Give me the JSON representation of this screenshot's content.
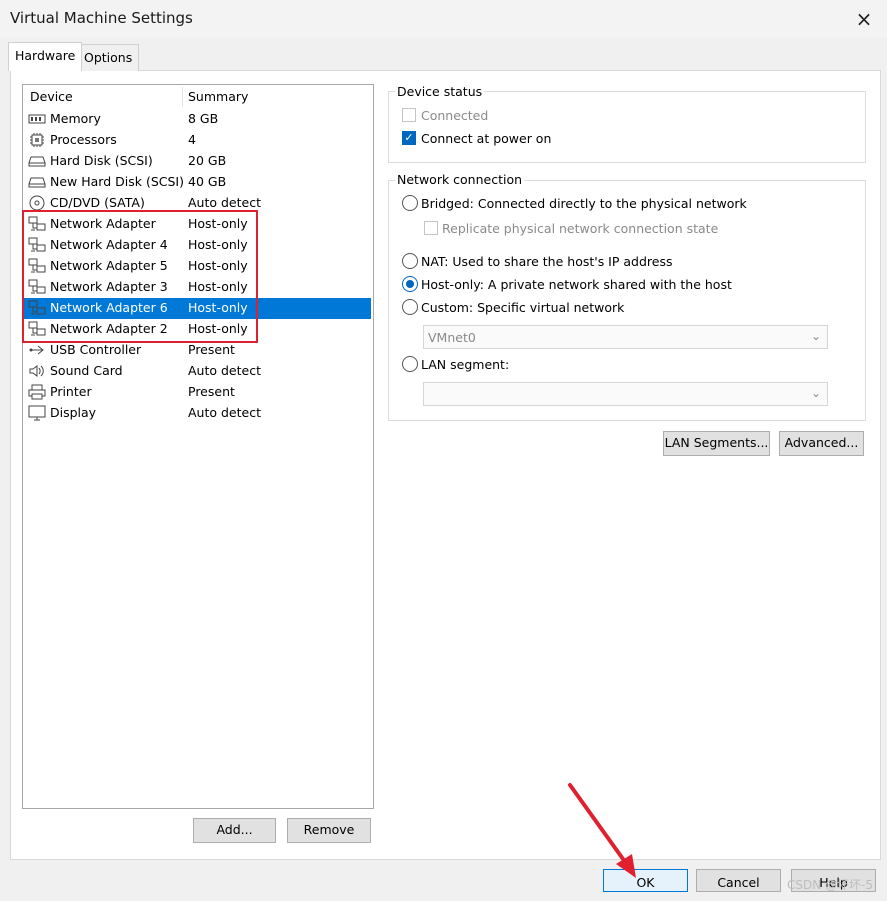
{
  "window": {
    "title": "Virtual Machine Settings",
    "close_icon": "×"
  },
  "tabs": [
    {
      "label": "Hardware",
      "active": true
    },
    {
      "label": "Options",
      "active": false
    }
  ],
  "device_list": {
    "columns": {
      "device": "Device",
      "summary": "Summary"
    },
    "rows": [
      {
        "name": "Memory",
        "summary": "8 GB",
        "icon": "memory-icon"
      },
      {
        "name": "Processors",
        "summary": "4",
        "icon": "processor-icon"
      },
      {
        "name": "Hard Disk (SCSI)",
        "summary": "20 GB",
        "icon": "hard-disk-icon"
      },
      {
        "name": "New Hard Disk (SCSI)",
        "summary": "40 GB",
        "icon": "hard-disk-icon"
      },
      {
        "name": "CD/DVD (SATA)",
        "summary": "Auto detect",
        "icon": "cd-dvd-icon"
      },
      {
        "name": "Network Adapter",
        "summary": "Host-only",
        "icon": "network-adapter-icon"
      },
      {
        "name": "Network Adapter 4",
        "summary": "Host-only",
        "icon": "network-adapter-icon"
      },
      {
        "name": "Network Adapter 5",
        "summary": "Host-only",
        "icon": "network-adapter-icon"
      },
      {
        "name": "Network Adapter 3",
        "summary": "Host-only",
        "icon": "network-adapter-icon"
      },
      {
        "name": "Network Adapter 6",
        "summary": "Host-only",
        "icon": "network-adapter-icon",
        "selected": true
      },
      {
        "name": "Network Adapter 2",
        "summary": "Host-only",
        "icon": "network-adapter-icon"
      },
      {
        "name": "USB Controller",
        "summary": "Present",
        "icon": "usb-icon"
      },
      {
        "name": "Sound Card",
        "summary": "Auto detect",
        "icon": "speaker-icon"
      },
      {
        "name": "Printer",
        "summary": "Present",
        "icon": "printer-icon"
      },
      {
        "name": "Display",
        "summary": "Auto detect",
        "icon": "monitor-icon"
      }
    ],
    "add_button": "Add...",
    "remove_button": "Remove"
  },
  "device_status": {
    "title": "Device status",
    "connected": {
      "label": "Connected",
      "checked": false,
      "disabled": true
    },
    "connect_power_on": {
      "label": "Connect at power on",
      "checked": true
    }
  },
  "network_connection": {
    "title": "Network connection",
    "bridged": "Bridged: Connected directly to the physical network",
    "replicate": "Replicate physical network connection state",
    "nat": "NAT: Used to share the host's IP address",
    "host_only": "Host-only: A private network shared with the host",
    "custom": "Custom: Specific virtual network",
    "vmnet_value": "VMnet0",
    "lan_segment": "LAN segment:",
    "lan_segment_value": "",
    "selected": "host_only"
  },
  "buttons": {
    "lan_segments": "LAN Segments...",
    "advanced": "Advanced...",
    "ok": "OK",
    "cancel": "Cancel",
    "help": "Help"
  },
  "watermark": "CSDN @坏坏-5",
  "colors": {
    "selection": "#0078d7",
    "annotation_red": "#e0202e",
    "accent": "#0067c0"
  }
}
